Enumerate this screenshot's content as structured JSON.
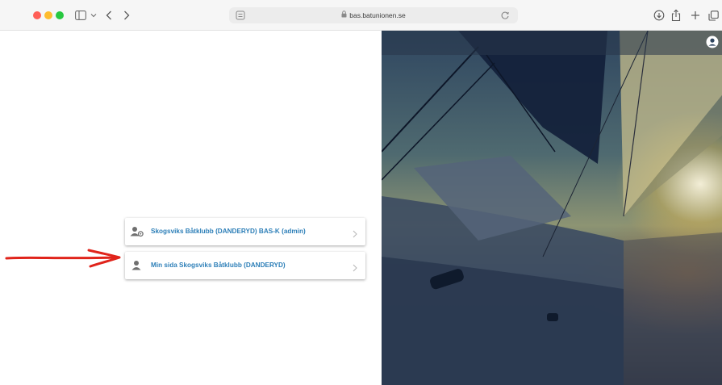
{
  "browser": {
    "url": "bas.batunionen.se"
  },
  "cards": [
    {
      "label": "Skogsviks Båtklubb (DANDERYD) BAS-K (admin)"
    },
    {
      "label": "Min sida Skogsviks Båtklubb (DANDERYD)"
    }
  ],
  "colors": {
    "link": "#2d7fb8",
    "annotation": "#e0241b"
  },
  "icons": [
    "sidebar-icon",
    "chevron-down-icon",
    "back-icon",
    "forward-icon",
    "lock-icon",
    "reload-icon",
    "download-icon",
    "share-icon",
    "new-tab-icon",
    "tabs-overview-icon",
    "user-icon",
    "admin-user-icon",
    "chevron-right-icon"
  ]
}
